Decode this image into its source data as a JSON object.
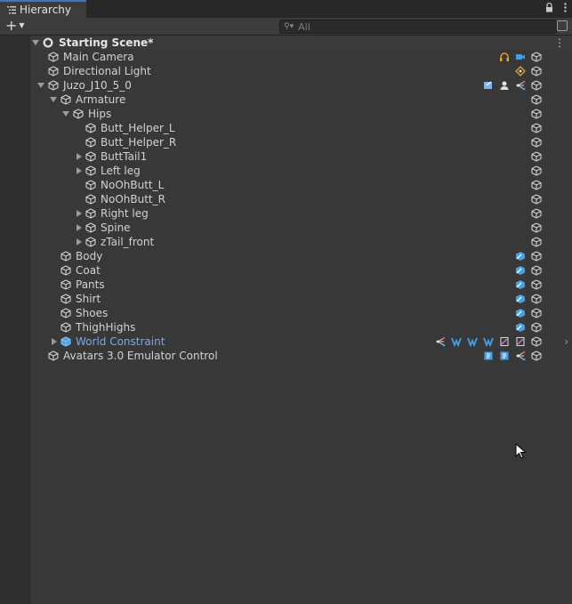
{
  "window": {
    "tab_label": "Hierarchy",
    "tab_icon": "list-icon",
    "lock_icon": "lock-icon",
    "menu_icon": "kebab-menu-icon"
  },
  "toolbar": {
    "add_label": "+",
    "search_placeholder": "All",
    "search_icon": "search-icon"
  },
  "scene": {
    "name": "Starting Scene*",
    "icon": "unity-logo-icon"
  },
  "rows": [
    {
      "name": "Main Camera",
      "depth": 0,
      "fold": "none",
      "icons": [
        "audio-listener-icon",
        "camera-icon",
        "prefab-cube-icon"
      ]
    },
    {
      "name": "Directional Light",
      "depth": 0,
      "fold": "none",
      "icons": [
        "light-icon",
        "prefab-cube-icon"
      ]
    },
    {
      "name": "Juzo_J10_5_0",
      "depth": 0,
      "fold": "open",
      "icons": [
        "animator-icon",
        "avatar-descriptor-icon",
        "constraint-icon",
        "prefab-cube-icon"
      ]
    },
    {
      "name": "Armature",
      "depth": 1,
      "fold": "open",
      "icons": [
        "prefab-cube-icon"
      ]
    },
    {
      "name": "Hips",
      "depth": 2,
      "fold": "open",
      "icons": [
        "prefab-cube-icon"
      ]
    },
    {
      "name": "Butt_Helper_L",
      "depth": 3,
      "fold": "none",
      "icons": [
        "prefab-cube-icon"
      ]
    },
    {
      "name": "Butt_Helper_R",
      "depth": 3,
      "fold": "none",
      "icons": [
        "prefab-cube-icon"
      ]
    },
    {
      "name": "ButtTail1",
      "depth": 3,
      "fold": "closed",
      "icons": [
        "prefab-cube-icon"
      ]
    },
    {
      "name": "Left leg",
      "depth": 3,
      "fold": "closed",
      "icons": [
        "prefab-cube-icon"
      ]
    },
    {
      "name": "NoOhButt_L",
      "depth": 3,
      "fold": "none",
      "icons": [
        "prefab-cube-icon"
      ]
    },
    {
      "name": "NoOhButt_R",
      "depth": 3,
      "fold": "none",
      "icons": [
        "prefab-cube-icon"
      ]
    },
    {
      "name": "Right leg",
      "depth": 3,
      "fold": "closed",
      "icons": [
        "prefab-cube-icon"
      ]
    },
    {
      "name": "Spine",
      "depth": 3,
      "fold": "closed",
      "icons": [
        "prefab-cube-icon"
      ]
    },
    {
      "name": "zTail_front",
      "depth": 3,
      "fold": "closed",
      "icons": [
        "prefab-cube-icon"
      ]
    },
    {
      "name": "Body",
      "depth": 1,
      "fold": "none",
      "icons": [
        "skinned-mesh-icon",
        "prefab-cube-icon"
      ]
    },
    {
      "name": "Coat",
      "depth": 1,
      "fold": "none",
      "icons": [
        "skinned-mesh-icon",
        "prefab-cube-icon"
      ]
    },
    {
      "name": "Pants",
      "depth": 1,
      "fold": "none",
      "icons": [
        "skinned-mesh-icon",
        "prefab-cube-icon"
      ]
    },
    {
      "name": "Shirt",
      "depth": 1,
      "fold": "none",
      "icons": [
        "skinned-mesh-icon",
        "prefab-cube-icon"
      ]
    },
    {
      "name": "Shoes",
      "depth": 1,
      "fold": "none",
      "icons": [
        "skinned-mesh-icon",
        "prefab-cube-icon"
      ]
    },
    {
      "name": "ThighHighs",
      "depth": 1,
      "fold": "none",
      "icons": [
        "skinned-mesh-icon",
        "prefab-cube-icon"
      ]
    },
    {
      "name": "World Constraint",
      "depth": 1,
      "fold": "closed",
      "prefab": true,
      "icons": [
        "constraint-icon",
        "vrc-constraint-icon",
        "vrc-constraint-icon",
        "vrc-constraint-icon",
        "script-icon",
        "script-icon",
        "prefab-cube-icon"
      ],
      "chevron": true
    },
    {
      "name": "Avatars 3.0 Emulator Control",
      "depth": 0,
      "fold": "none",
      "icons": [
        "script-blue-icon",
        "script-blue-icon",
        "constraint-icon",
        "prefab-cube-icon"
      ]
    }
  ],
  "colors": {
    "accent": "#3a79bb",
    "prefab_text": "#7aa8e8",
    "audio": "#e8a32b",
    "camera": "#3fa0e8"
  }
}
